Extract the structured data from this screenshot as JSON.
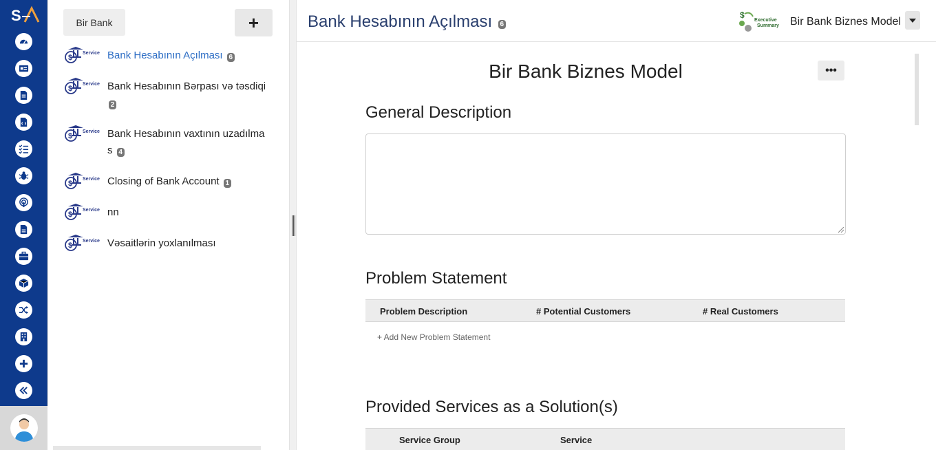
{
  "app": {
    "logo": "SA"
  },
  "rail": {
    "icons": [
      "dashboard-icon",
      "id-card-icon",
      "document-icon",
      "code-file-icon",
      "checklist-icon",
      "bug-icon",
      "podcast-icon",
      "file-icon",
      "briefcase-icon",
      "cube-icon",
      "shuffle-icon",
      "building-icon",
      "plus-icon",
      "collapse-icon"
    ]
  },
  "list": {
    "breadcrumb": "Bir Bank",
    "add_label": "+",
    "service_tag": "Service",
    "items": [
      {
        "label": "Bank Hesabının Açılması",
        "count": "6",
        "active": true
      },
      {
        "label": "Bank Hesabının Bərpası və təsdiqi",
        "count": "2"
      },
      {
        "label": "Bank Hesabının vaxtının uzadılma s",
        "count": "4"
      },
      {
        "label": "Closing of Bank Account",
        "count": "1"
      },
      {
        "label": "nn",
        "count": ""
      },
      {
        "label": "Vəsaitlərin yoxlanılması",
        "count": ""
      }
    ]
  },
  "main": {
    "title": "Bank Hesabının Açılması",
    "title_count": "6",
    "exec_logo_text": "Executive Summary",
    "model_name": "Bir Bank Biznes Model",
    "doc_title": "Bir Bank Biznes Model",
    "more_label": "•••",
    "general_description": {
      "title": "General Description",
      "value": ""
    },
    "problem_statement": {
      "title": "Problem Statement",
      "columns": [
        "Problem Description",
        "# Potential Customers",
        "# Real Customers"
      ],
      "add_label": "+ Add New Problem Statement"
    },
    "solutions": {
      "title": "Provided Services as a Solution(s)",
      "columns": [
        "Service Group",
        "Service"
      ]
    }
  },
  "colors": {
    "rail": "#0e3a8c",
    "accent": "#2b6cc4",
    "title": "#2a3f6e"
  }
}
